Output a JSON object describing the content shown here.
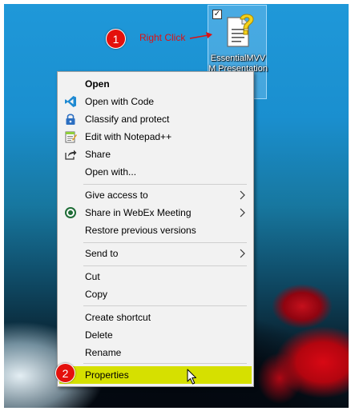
{
  "desktop_icon": {
    "label": "EssentialMVVM Presentation",
    "checked": "✓",
    "icon": "help-document-icon"
  },
  "annotations": {
    "step1_number": "1",
    "step1_text": "Right Click",
    "step2_number": "2"
  },
  "context_menu": {
    "items": [
      {
        "label": "Open",
        "icon": ""
      },
      {
        "label": "Open with Code",
        "icon": "vscode-icon"
      },
      {
        "label": "Classify and protect",
        "icon": "lock-icon"
      },
      {
        "label": "Edit with Notepad++",
        "icon": "notepadpp-icon"
      },
      {
        "label": "Share",
        "icon": "share-icon"
      },
      {
        "label": "Open with...",
        "icon": ""
      },
      {
        "label": "Give access to",
        "icon": "",
        "submenu": true
      },
      {
        "label": "Share in WebEx Meeting",
        "icon": "webex-icon",
        "submenu": true
      },
      {
        "label": "Restore previous versions",
        "icon": ""
      },
      {
        "label": "Send to",
        "icon": "",
        "submenu": true
      },
      {
        "label": "Cut",
        "icon": ""
      },
      {
        "label": "Copy",
        "icon": ""
      },
      {
        "label": "Create shortcut",
        "icon": ""
      },
      {
        "label": "Delete",
        "icon": ""
      },
      {
        "label": "Rename",
        "icon": ""
      },
      {
        "label": "Properties",
        "icon": "",
        "highlighted": true
      }
    ]
  },
  "colors": {
    "highlight": "#d6e000",
    "badge": "#e4100c",
    "annotation_text": "#e01010"
  }
}
